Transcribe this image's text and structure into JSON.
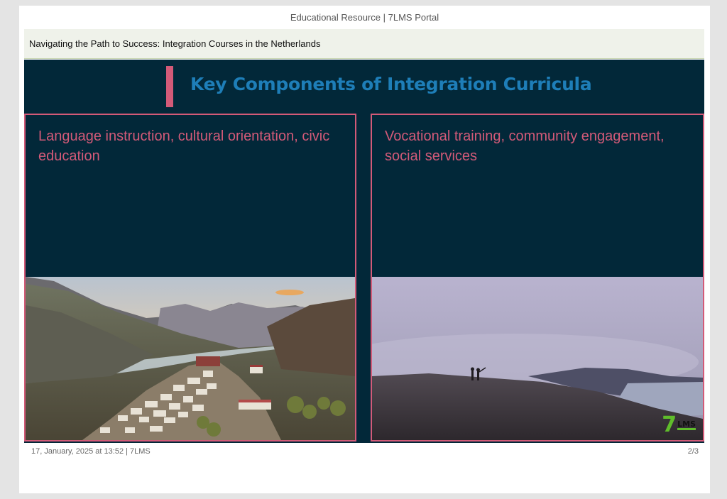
{
  "portal": {
    "header_title": "Educational Resource | 7LMS Portal"
  },
  "course": {
    "title": "Navigating the Path to Success: Integration Courses in the Netherlands"
  },
  "slide": {
    "title": "Key Components of Integration Curricula",
    "columns": [
      {
        "text": "Language instruction, cultural orientation, civic education",
        "image": "mountain-monastery-photo"
      },
      {
        "text": "Vocational training, community engagement, social services",
        "image": "misty-hilltop-photo"
      }
    ],
    "logo_seven": "7",
    "logo_lms": "LMS"
  },
  "footer": {
    "timestamp": "17, January, 2025 at 13:52 | 7LMS",
    "page_indicator": "2/3"
  },
  "colors": {
    "slide_background": "#022839",
    "title": "#1e7eb8",
    "accent": "#d35a78",
    "logo_green": "#5fbd2b"
  }
}
